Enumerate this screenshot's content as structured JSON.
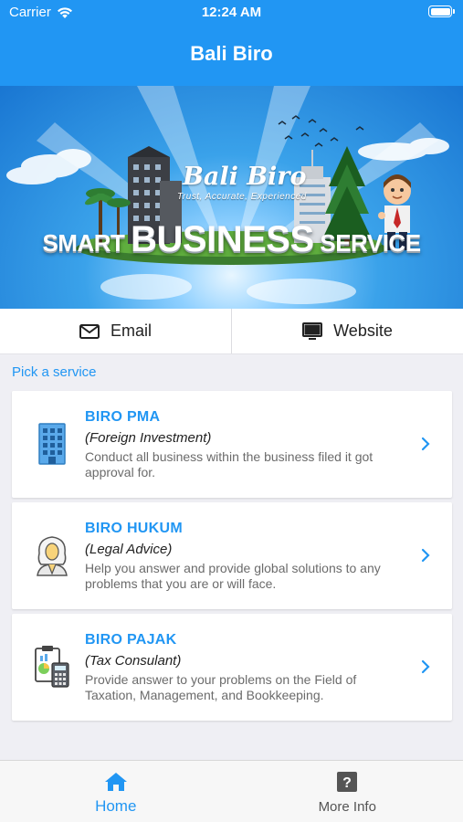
{
  "status_bar": {
    "carrier": "Carrier",
    "time": "12:24 AM"
  },
  "app": {
    "title": "Bali Biro"
  },
  "banner": {
    "logo": "Bali Biro",
    "tagline": "Trust, Accurate, Experienced",
    "headline_word_1": "SMART",
    "headline_word_2": "BUSINESS",
    "headline_word_3": "SERVICE"
  },
  "actions": {
    "email_label": "Email",
    "email_icon": "envelope-icon",
    "website_label": "Website",
    "website_icon": "monitor-icon"
  },
  "section": {
    "label": "Pick a service"
  },
  "services": [
    {
      "title": "BIRO PMA",
      "subtitle": "(Foreign Investment)",
      "description": "Conduct all business within the business filed it got approval for.",
      "icon": "office-building-icon"
    },
    {
      "title": "BIRO HUKUM",
      "subtitle": "(Legal Advice)",
      "description": "Help you answer and provide global solutions to any problems that you are or will face.",
      "icon": "lawyer-icon"
    },
    {
      "title": "BIRO PAJAK",
      "subtitle": "(Tax Consulant)",
      "description": "Provide answer to your problems on the Field of Taxation, Management, and Bookkeeping.",
      "icon": "calculator-clipboard-icon"
    }
  ],
  "tabs": [
    {
      "label": "Home",
      "icon": "home-icon",
      "active": true
    },
    {
      "label": "More Info",
      "icon": "question-icon",
      "active": false
    }
  ],
  "colors": {
    "accent": "#2196f3",
    "background": "#efeff4",
    "card": "#ffffff",
    "description_text": "#6b6b6b"
  }
}
